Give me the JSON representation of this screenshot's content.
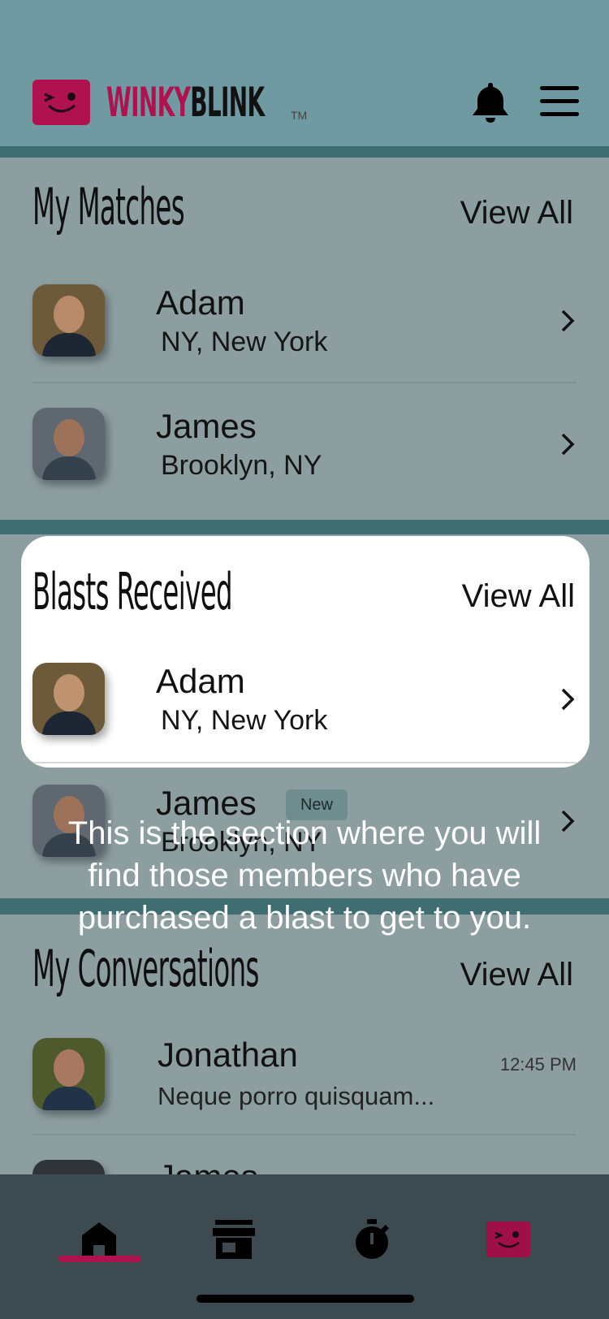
{
  "header": {
    "logo_part1": "WINKY",
    "logo_part2": "BLINK",
    "logo_tm": "TM",
    "icons": [
      "bell-icon",
      "hamburger-menu-icon"
    ]
  },
  "matches": {
    "title": "My Matches",
    "view_all": "View All",
    "items": [
      {
        "name": "Adam",
        "location": "NY, New York"
      },
      {
        "name": "James",
        "location": "Brooklyn, NY"
      }
    ]
  },
  "blasts": {
    "title": "Blasts Received",
    "view_all": "View All",
    "items": [
      {
        "name": "Adam",
        "location": "NY, New York"
      },
      {
        "name": "James",
        "location": "Brooklyn, NY",
        "badge": "New"
      }
    ]
  },
  "conversations": {
    "title": "My Conversations",
    "view_all": "View All",
    "items": [
      {
        "name": "Jonathan",
        "preview": "Neque porro quisquam...",
        "time": "12:45 PM"
      },
      {
        "name": "James"
      }
    ]
  },
  "tooltip": {
    "text": "This is the section where you will find those members who have purchased a blast to get to you."
  },
  "tabbar": {
    "tabs": [
      {
        "icon": "home-icon",
        "active": true
      },
      {
        "icon": "store-icon",
        "active": false
      },
      {
        "icon": "stopwatch-icon",
        "active": false
      },
      {
        "icon": "winkyblink-face-icon",
        "active": false
      }
    ]
  },
  "colors": {
    "brand": "#b0124f",
    "header_bg": "#6f9aa2",
    "band": "#3f6e72",
    "overlay_bg": "#8d9ea1",
    "tabbar_bg": "#3d4a4f"
  }
}
